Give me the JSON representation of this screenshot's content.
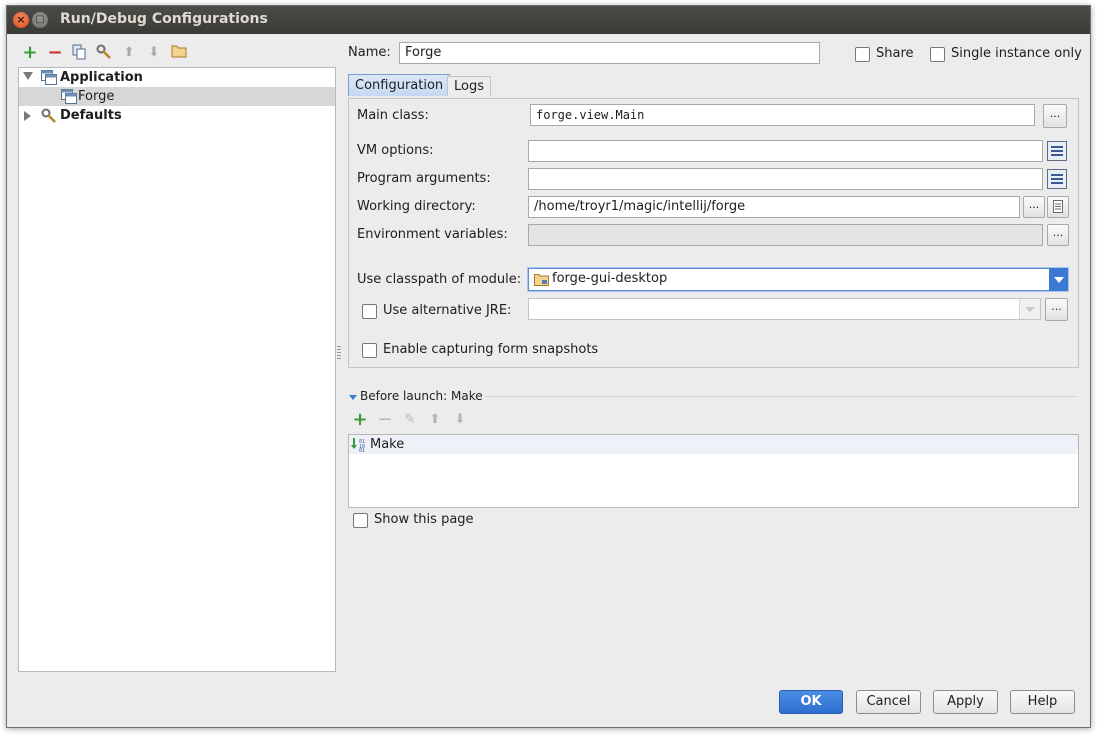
{
  "window": {
    "title": "Run/Debug Configurations"
  },
  "icons": {
    "add": "+",
    "remove": "−",
    "copy": "▯",
    "wrench": "⚙",
    "up": "⬆",
    "down": "⬇",
    "folder": "▭",
    "edit": "✎",
    "ellipsis": "..."
  },
  "tree": {
    "application_label": "Application",
    "forge_label": "Forge",
    "defaults_label": "Defaults"
  },
  "header": {
    "name_label": "Name:",
    "name_value": "Forge",
    "share_label": "Share",
    "single_instance_label": "Single instance only"
  },
  "tabs": {
    "configuration": "Configuration",
    "logs": "Logs"
  },
  "form": {
    "main_class_label": "Main class:",
    "main_class_value": "forge.view.Main",
    "vm_options_label": "VM options:",
    "program_arguments_label": "Program arguments:",
    "working_directory_label": "Working directory:",
    "working_directory_value": "/home/troyr1/magic/intellij/forge",
    "environment_variables_label": "Environment variables:",
    "use_classpath_label": "Use classpath of module:",
    "classpath_module_value": "forge-gui-desktop",
    "use_alternative_jre_label": "Use alternative JRE:",
    "enable_snapshots_label": "Enable capturing form snapshots"
  },
  "before_launch": {
    "header": "Before launch: Make",
    "items": [
      "Make"
    ],
    "show_this_page_label": "Show this page"
  },
  "buttons": {
    "ok": "OK",
    "cancel": "Cancel",
    "apply": "Apply",
    "help": "Help"
  },
  "colors": {
    "accent": "#3b79d3",
    "add_green": "#3a9a3a",
    "remove_red": "#c9322b"
  }
}
